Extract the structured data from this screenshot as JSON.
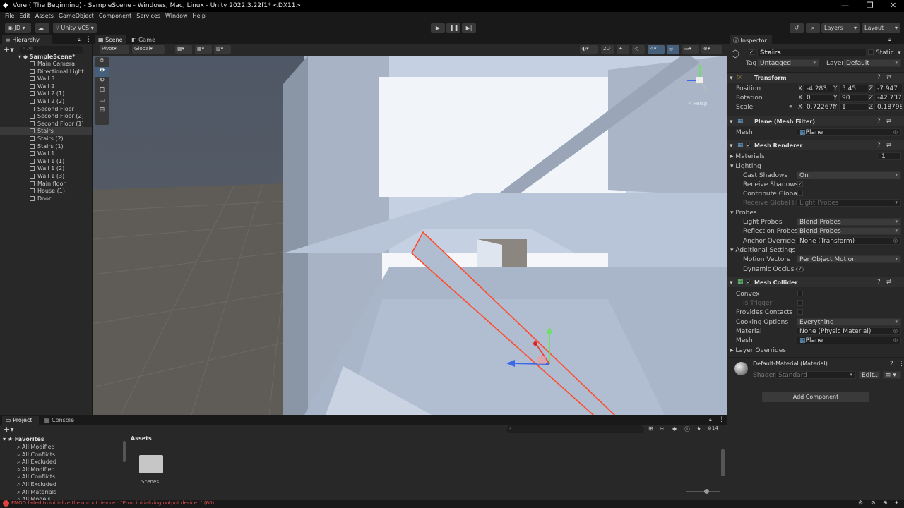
{
  "titlebar": {
    "title": "Vore ( The Beginning) - SampleScene - Windows, Mac, Linux - Unity 2022.3.22f1* <DX11>",
    "min": "—",
    "max": "❐",
    "close": "✕"
  },
  "menubar": [
    "File",
    "Edit",
    "Assets",
    "GameObject",
    "Component",
    "Services",
    "Window",
    "Help"
  ],
  "toolbar": {
    "account": "JD",
    "vcs": "Unity VCS",
    "layers": "Layers",
    "layout": "Layout"
  },
  "hierarchy": {
    "tab": "Hierarchy",
    "search_placeholder": "All",
    "scene": "SampleScene*",
    "items": [
      "Main Camera",
      "Directional Light",
      "Wall 3",
      "Wall 2",
      "Wall 2 (1)",
      "Wall 2 (2)",
      "Second Floor",
      "Second Floor (2)",
      "Second Floor (1)",
      "Stairs",
      "Stairs (2)",
      "Stairs (1)",
      "Wall 1",
      "Wall 1 (1)",
      "Wall 1 (2)",
      "Wall 1 (3)",
      "Main floor",
      "House (1)",
      "Door"
    ],
    "selected": "Stairs"
  },
  "scene": {
    "tabs": [
      "Scene",
      "Game"
    ],
    "pivot": "Pivot",
    "global": "Global",
    "mode2d": "2D",
    "persp": "< Persp"
  },
  "inspector": {
    "tab": "Inspector",
    "object_name": "Stairs",
    "static": "Static",
    "tag_label": "Tag",
    "tag": "Untagged",
    "layer_label": "Layer",
    "layer": "Default",
    "transform": {
      "title": "Transform",
      "position_label": "Position",
      "rotation_label": "Rotation",
      "scale_label": "Scale",
      "position": {
        "x": "-4.283",
        "y": "5.45",
        "z": "-7.947"
      },
      "rotation": {
        "x": "0",
        "y": "90",
        "z": "-42.737"
      },
      "scale": {
        "x": "0.722678",
        "y": "1",
        "z": "0.18798"
      }
    },
    "mesh_filter": {
      "title": "Plane (Mesh Filter)",
      "mesh_label": "Mesh",
      "mesh": "Plane"
    },
    "mesh_renderer": {
      "title": "Mesh Renderer",
      "materials_label": "Materials",
      "materials_count": "1",
      "lighting": "Lighting",
      "cast_shadows_label": "Cast Shadows",
      "cast_shadows": "On",
      "receive_shadows_label": "Receive Shadows",
      "contribute_gi_label": "Contribute Global Illu",
      "receive_gi_label": "Receive Global Illum",
      "receive_gi": "Light Probes",
      "probes": "Probes",
      "light_probes_label": "Light Probes",
      "light_probes": "Blend Probes",
      "reflection_probes_label": "Reflection Probes",
      "reflection_probes": "Blend Probes",
      "anchor_override_label": "Anchor Override",
      "anchor_override": "None (Transform)",
      "additional": "Additional Settings",
      "motion_vectors_label": "Motion Vectors",
      "motion_vectors": "Per Object Motion",
      "dynamic_occlusion_label": "Dynamic Occlusion"
    },
    "mesh_collider": {
      "title": "Mesh Collider",
      "convex_label": "Convex",
      "is_trigger_label": "Is Trigger",
      "provides_contacts_label": "Provides Contacts",
      "cooking_label": "Cooking Options",
      "cooking": "Everything",
      "material_label": "Material",
      "material": "None (Physic Material)",
      "mesh_label": "Mesh",
      "mesh": "Plane",
      "layer_overrides": "Layer Overrides"
    },
    "material": {
      "name": "Default-Material (Material)",
      "shader_label": "Shader",
      "shader": "Standard",
      "edit": "Edit..."
    },
    "add_component": "Add Component"
  },
  "project": {
    "tabs": [
      "Project",
      "Console"
    ],
    "favorites": "Favorites",
    "fav_items": [
      "All Modified",
      "All Conflicts",
      "All Excluded",
      "All Modified",
      "All Conflicts",
      "All Excluded",
      "All Materials",
      "All Models"
    ],
    "assets": "Assets",
    "folder": "Scenes",
    "count": "14"
  },
  "status": {
    "error": "FMOD failed to initialize the output device.: \"Error initializing output device. \" (60)"
  }
}
